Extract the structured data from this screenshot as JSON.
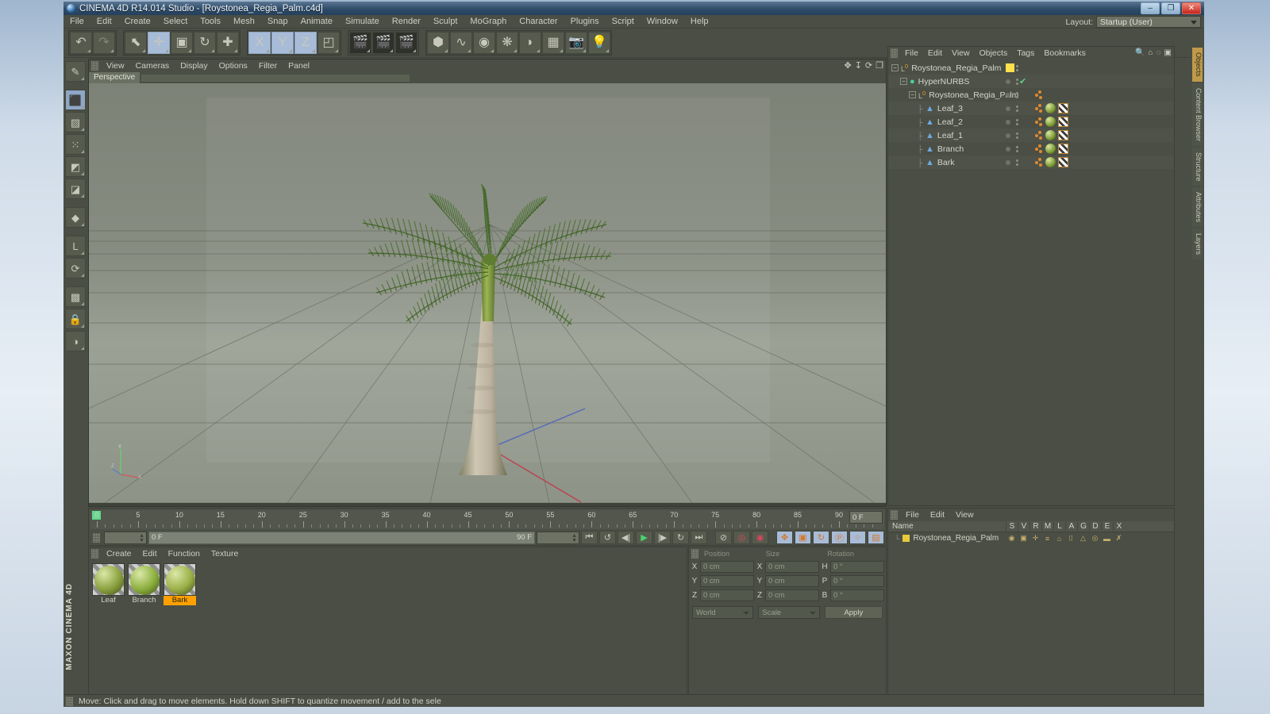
{
  "window": {
    "title": "CINEMA 4D R14.014 Studio - [Roystonea_Regia_Palm.c4d]",
    "minimize": "–",
    "maximize": "❐",
    "close": "✕"
  },
  "menubar": {
    "items": [
      "File",
      "Edit",
      "Create",
      "Select",
      "Tools",
      "Mesh",
      "Snap",
      "Animate",
      "Simulate",
      "Render",
      "Sculpt",
      "MoGraph",
      "Character",
      "Plugins",
      "Script",
      "Window",
      "Help"
    ],
    "layout_label": "Layout:",
    "layout_value": "Startup (User)"
  },
  "toolbar": {
    "groups": [
      {
        "name": "undo-redo",
        "buttons": [
          {
            "name": "undo-button",
            "glyph": "↶",
            "state": "normal"
          },
          {
            "name": "redo-button",
            "glyph": "↷",
            "state": "disabled"
          }
        ]
      },
      {
        "name": "transform-tools",
        "buttons": [
          {
            "name": "live-selection-tool",
            "glyph": "⬉",
            "state": "normal"
          },
          {
            "name": "move-tool",
            "glyph": "✛",
            "state": "selected"
          },
          {
            "name": "scale-tool",
            "glyph": "▣",
            "state": "normal"
          },
          {
            "name": "rotate-tool",
            "glyph": "↻",
            "state": "normal"
          },
          {
            "name": "plus-tool",
            "glyph": "✚",
            "state": "normal"
          }
        ]
      },
      {
        "name": "axis-locks",
        "buttons": [
          {
            "name": "x-axis-lock",
            "glyph": "X",
            "state": "selected"
          },
          {
            "name": "y-axis-lock",
            "glyph": "Y",
            "state": "selected"
          },
          {
            "name": "z-axis-lock",
            "glyph": "Z",
            "state": "selected"
          },
          {
            "name": "world-object-axis",
            "glyph": "◰",
            "state": "normal"
          }
        ]
      },
      {
        "name": "render-tools",
        "buttons": [
          {
            "name": "render-view-button",
            "glyph": "🎬",
            "state": "dark"
          },
          {
            "name": "render-region-button",
            "glyph": "🎬",
            "state": "dark"
          },
          {
            "name": "render-settings-button",
            "glyph": "🎬",
            "state": "dark"
          }
        ]
      },
      {
        "name": "object-tools",
        "buttons": [
          {
            "name": "add-cube-button",
            "glyph": "⬢",
            "state": "normal"
          },
          {
            "name": "add-spline-button",
            "glyph": "∿",
            "state": "normal"
          },
          {
            "name": "add-nurbs-button",
            "glyph": "◉",
            "state": "normal"
          },
          {
            "name": "add-array-button",
            "glyph": "❋",
            "state": "normal"
          },
          {
            "name": "add-deformer-button",
            "glyph": "◗",
            "state": "normal"
          },
          {
            "name": "add-scene-button",
            "glyph": "▦",
            "state": "normal"
          },
          {
            "name": "add-camera-button",
            "glyph": "📷",
            "state": "normal"
          },
          {
            "name": "add-light-button",
            "glyph": "💡",
            "state": "normal"
          }
        ]
      }
    ]
  },
  "left_toolbar": {
    "buttons": [
      {
        "name": "make-editable-button",
        "glyph": "✎"
      },
      {
        "name": "model-mode-button",
        "glyph": "⬛"
      },
      {
        "name": "texture-mode-button",
        "glyph": "▨"
      },
      {
        "name": "points-mode-button",
        "glyph": "⁙"
      },
      {
        "name": "edges-mode-button",
        "glyph": "◩"
      },
      {
        "name": "polygons-mode-button",
        "glyph": "◪"
      },
      {
        "name": "object-axis-button",
        "glyph": "◆"
      },
      {
        "name": "enable-axis-button",
        "glyph": "L"
      },
      {
        "name": "enable-snap-button",
        "glyph": "⟳"
      },
      {
        "name": "workplane-button",
        "glyph": "▩"
      },
      {
        "name": "lock-workplane-button",
        "glyph": "🔒"
      },
      {
        "name": "workplane-mode-button",
        "glyph": "◑"
      }
    ],
    "brand": "MAXON CINEMA 4D"
  },
  "viewport": {
    "menu": [
      "View",
      "Cameras",
      "Display",
      "Options",
      "Filter",
      "Panel"
    ],
    "tab_label": "Perspective",
    "corner_icons": [
      "✥",
      "↧",
      "⟳",
      "❐"
    ],
    "axis_labels": {
      "y": "Y",
      "x": "X",
      "z": "Z"
    }
  },
  "timeline": {
    "tick_labels": [
      "0",
      "5",
      "10",
      "15",
      "20",
      "25",
      "30",
      "35",
      "40",
      "45",
      "50",
      "55",
      "60",
      "65",
      "70",
      "75",
      "80",
      "85",
      "90"
    ],
    "current_frame_field": "0 F",
    "start_field": "0 F",
    "scrub_left": "0 F",
    "scrub_right": "90 F",
    "end_field": "90 F",
    "transport": [
      {
        "name": "go-to-start-button",
        "glyph": "⏮"
      },
      {
        "name": "previous-key-button",
        "glyph": "↺"
      },
      {
        "name": "previous-frame-button",
        "glyph": "◀|"
      },
      {
        "name": "play-forward-button",
        "glyph": "▶"
      },
      {
        "name": "next-frame-button",
        "glyph": "|▶"
      },
      {
        "name": "next-key-button",
        "glyph": "↻"
      },
      {
        "name": "go-to-end-button",
        "glyph": "⏭"
      }
    ],
    "record_tools": [
      {
        "name": "record-active-objects-button",
        "glyph": "⊘"
      },
      {
        "name": "autokeying-button",
        "glyph": "◎"
      },
      {
        "name": "keyframe-selection-button",
        "glyph": "◉"
      }
    ],
    "key_toggles": [
      {
        "name": "position-key-button",
        "glyph": "✥"
      },
      {
        "name": "scale-key-button",
        "glyph": "▣"
      },
      {
        "name": "rotation-key-button",
        "glyph": "↻"
      },
      {
        "name": "parameter-key-button",
        "glyph": "Ⓟ"
      },
      {
        "name": "pla-key-button",
        "glyph": "⁘"
      },
      {
        "name": "animation-mode-button",
        "glyph": "▤"
      }
    ]
  },
  "material_manager": {
    "menu": [
      "Create",
      "Edit",
      "Function",
      "Texture"
    ],
    "materials": [
      {
        "name": "Leaf",
        "color": "#8aa03e",
        "selected": false
      },
      {
        "name": "Branch",
        "color": "#8aae3c",
        "selected": false
      },
      {
        "name": "Bark",
        "color": "#9aae46",
        "selected": true
      }
    ]
  },
  "coordinates": {
    "headers": [
      "Position",
      "Size",
      "Rotation"
    ],
    "rows": [
      {
        "label1": "X",
        "v1": "0 cm",
        "label2": "X",
        "v2": "0 cm",
        "label3": "H",
        "v3": "0 °"
      },
      {
        "label1": "Y",
        "v1": "0 cm",
        "label2": "Y",
        "v2": "0 cm",
        "label3": "P",
        "v3": "0 °"
      },
      {
        "label1": "Z",
        "v1": "0 cm",
        "label2": "Z",
        "v2": "0 cm",
        "label3": "B",
        "v3": "0 °"
      }
    ],
    "system_select": "World",
    "mode_select": "Scale",
    "apply_button": "Apply"
  },
  "object_manager": {
    "menu": [
      "File",
      "Edit",
      "View",
      "Objects",
      "Tags",
      "Bookmarks"
    ],
    "icons": [
      "🔍",
      "⌂",
      "◌",
      "▣"
    ],
    "rows": [
      {
        "name": "Roystonea_Regia_Palm",
        "depth": 0,
        "icon": "null",
        "expander": true,
        "layer_color": "#ffe14d",
        "check": false,
        "tags": []
      },
      {
        "name": "HyperNURBS",
        "depth": 1,
        "icon": "hypernurbs",
        "expander": true,
        "layer_color": "",
        "check": true,
        "tags": []
      },
      {
        "name": "Roystonea_Regia_Palm",
        "depth": 2,
        "icon": "null",
        "expander": true,
        "layer_color": "",
        "check": false,
        "tags": [
          "dots"
        ]
      },
      {
        "name": "Leaf_3",
        "depth": 3,
        "icon": "polygon",
        "expander": false,
        "layer_color": "",
        "check": false,
        "tags": [
          "dots",
          "mat",
          "uv"
        ]
      },
      {
        "name": "Leaf_2",
        "depth": 3,
        "icon": "polygon",
        "expander": false,
        "layer_color": "",
        "check": false,
        "tags": [
          "dots",
          "mat",
          "uv"
        ]
      },
      {
        "name": "Leaf_1",
        "depth": 3,
        "icon": "polygon",
        "expander": false,
        "layer_color": "",
        "check": false,
        "tags": [
          "dots",
          "mat",
          "uv"
        ]
      },
      {
        "name": "Branch",
        "depth": 3,
        "icon": "polygon",
        "expander": false,
        "layer_color": "",
        "check": false,
        "tags": [
          "dots",
          "mat",
          "uv"
        ]
      },
      {
        "name": "Bark",
        "depth": 3,
        "icon": "polygon",
        "expander": false,
        "layer_color": "",
        "check": false,
        "tags": [
          "dots",
          "mat",
          "uv"
        ]
      }
    ]
  },
  "layer_manager": {
    "menu": [
      "File",
      "Edit",
      "View"
    ],
    "columns": [
      "Name",
      "S",
      "V",
      "R",
      "M",
      "L",
      "A",
      "G",
      "D",
      "E",
      "X"
    ],
    "rows": [
      {
        "name": "Roystonea_Regia_Palm",
        "swatch": "#e8c83c"
      }
    ]
  },
  "right_tabs": [
    {
      "label": "Objects",
      "active": true
    },
    {
      "label": "Content Browser",
      "active": false
    },
    {
      "label": "Structure",
      "active": false
    },
    {
      "label": "Attributes",
      "active": false
    },
    {
      "label": "Layers",
      "active": false
    }
  ],
  "status_bar": {
    "text": "Move: Click and drag to move elements. Hold down SHIFT to quantize movement / add to the sele"
  }
}
